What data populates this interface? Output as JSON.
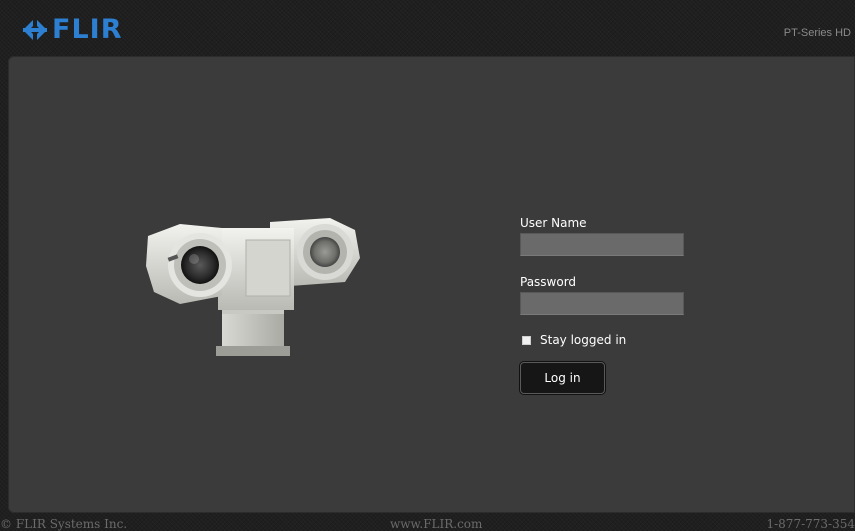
{
  "header": {
    "brand": "FLIR",
    "product": "PT-Series HD",
    "brand_color": "#2c7fd1"
  },
  "hero": {
    "image_icon": "ptz-thermal-camera-image"
  },
  "login": {
    "username_label": "User Name",
    "username_value": "",
    "password_label": "Password",
    "password_value": "",
    "stay_logged_in_label": "Stay logged in",
    "stay_logged_in_checked": false,
    "submit_label": "Log in"
  },
  "footer": {
    "copyright": "© FLIR Systems Inc.",
    "website": "www.FLIR.com",
    "phone": "1-877-773-354"
  }
}
